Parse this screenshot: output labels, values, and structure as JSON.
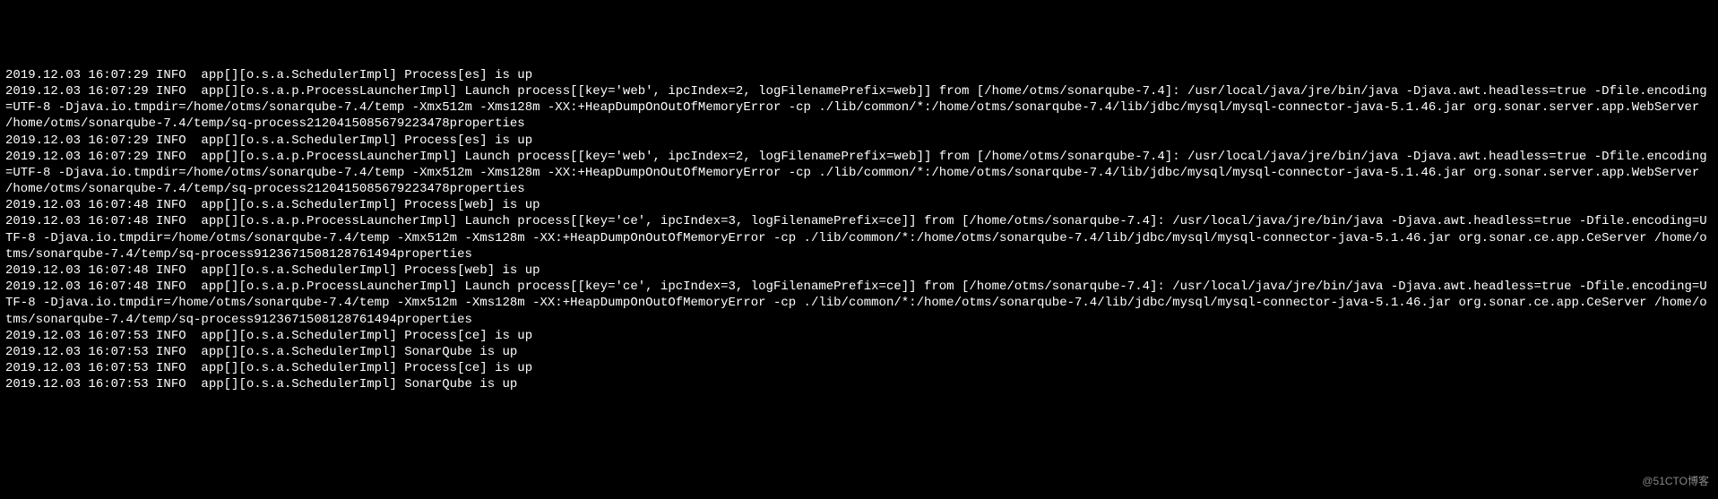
{
  "log_lines": [
    "2019.12.03 16:07:29 INFO  app[][o.s.a.SchedulerImpl] Process[es] is up",
    "2019.12.03 16:07:29 INFO  app[][o.s.a.p.ProcessLauncherImpl] Launch process[[key='web', ipcIndex=2, logFilenamePrefix=web]] from [/home/otms/sonarqube-7.4]: /usr/local/java/jre/bin/java -Djava.awt.headless=true -Dfile.encoding=UTF-8 -Djava.io.tmpdir=/home/otms/sonarqube-7.4/temp -Xmx512m -Xms128m -XX:+HeapDumpOnOutOfMemoryError -cp ./lib/common/*:/home/otms/sonarqube-7.4/lib/jdbc/mysql/mysql-connector-java-5.1.46.jar org.sonar.server.app.WebServer /home/otms/sonarqube-7.4/temp/sq-process2120415085679223478properties",
    "2019.12.03 16:07:29 INFO  app[][o.s.a.SchedulerImpl] Process[es] is up",
    "2019.12.03 16:07:29 INFO  app[][o.s.a.p.ProcessLauncherImpl] Launch process[[key='web', ipcIndex=2, logFilenamePrefix=web]] from [/home/otms/sonarqube-7.4]: /usr/local/java/jre/bin/java -Djava.awt.headless=true -Dfile.encoding=UTF-8 -Djava.io.tmpdir=/home/otms/sonarqube-7.4/temp -Xmx512m -Xms128m -XX:+HeapDumpOnOutOfMemoryError -cp ./lib/common/*:/home/otms/sonarqube-7.4/lib/jdbc/mysql/mysql-connector-java-5.1.46.jar org.sonar.server.app.WebServer /home/otms/sonarqube-7.4/temp/sq-process2120415085679223478properties",
    "2019.12.03 16:07:48 INFO  app[][o.s.a.SchedulerImpl] Process[web] is up",
    "2019.12.03 16:07:48 INFO  app[][o.s.a.p.ProcessLauncherImpl] Launch process[[key='ce', ipcIndex=3, logFilenamePrefix=ce]] from [/home/otms/sonarqube-7.4]: /usr/local/java/jre/bin/java -Djava.awt.headless=true -Dfile.encoding=UTF-8 -Djava.io.tmpdir=/home/otms/sonarqube-7.4/temp -Xmx512m -Xms128m -XX:+HeapDumpOnOutOfMemoryError -cp ./lib/common/*:/home/otms/sonarqube-7.4/lib/jdbc/mysql/mysql-connector-java-5.1.46.jar org.sonar.ce.app.CeServer /home/otms/sonarqube-7.4/temp/sq-process9123671508128761494properties",
    "2019.12.03 16:07:48 INFO  app[][o.s.a.SchedulerImpl] Process[web] is up",
    "2019.12.03 16:07:48 INFO  app[][o.s.a.p.ProcessLauncherImpl] Launch process[[key='ce', ipcIndex=3, logFilenamePrefix=ce]] from [/home/otms/sonarqube-7.4]: /usr/local/java/jre/bin/java -Djava.awt.headless=true -Dfile.encoding=UTF-8 -Djava.io.tmpdir=/home/otms/sonarqube-7.4/temp -Xmx512m -Xms128m -XX:+HeapDumpOnOutOfMemoryError -cp ./lib/common/*:/home/otms/sonarqube-7.4/lib/jdbc/mysql/mysql-connector-java-5.1.46.jar org.sonar.ce.app.CeServer /home/otms/sonarqube-7.4/temp/sq-process9123671508128761494properties",
    "2019.12.03 16:07:53 INFO  app[][o.s.a.SchedulerImpl] Process[ce] is up",
    "2019.12.03 16:07:53 INFO  app[][o.s.a.SchedulerImpl] SonarQube is up",
    "2019.12.03 16:07:53 INFO  app[][o.s.a.SchedulerImpl] Process[ce] is up",
    "2019.12.03 16:07:53 INFO  app[][o.s.a.SchedulerImpl] SonarQube is up"
  ],
  "watermark": "@51CTO博客"
}
